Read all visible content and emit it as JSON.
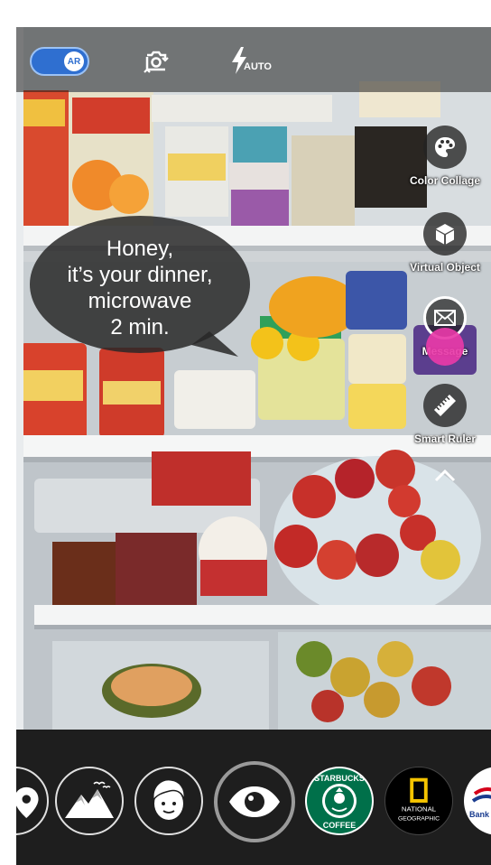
{
  "toolbar": {
    "ar_label": "AR",
    "ar_enabled": true,
    "camera_switch_icon": "camera-switch-icon",
    "flash_icon": "flash-auto-icon",
    "flash_label": "AUTO"
  },
  "bubble": {
    "lines": [
      "Honey,",
      "it’s your dinner,",
      "microwave",
      "2 min."
    ]
  },
  "side_tools": [
    {
      "label": "Color Collage",
      "icon": "palette-icon"
    },
    {
      "label": "Virtual Object",
      "icon": "cube-icon"
    },
    {
      "label": "Message",
      "icon": "envelope-icon",
      "selected": true
    },
    {
      "label": "Smart Ruler",
      "icon": "ruler-icon"
    }
  ],
  "filters": [
    {
      "name": "location",
      "icon": "location-pin-icon"
    },
    {
      "name": "mountains",
      "icon": "mountains-icon"
    },
    {
      "name": "face",
      "icon": "face-icon"
    },
    {
      "name": "eye",
      "icon": "eye-icon",
      "selected": true
    },
    {
      "name": "Starbucks",
      "icon": "starbucks-logo",
      "text_top": "STARBUCKS",
      "text_bottom": "COFFEE"
    },
    {
      "name": "National Geographic",
      "icon": "natgeo-logo",
      "text_1": "NATIONAL",
      "text_2": "GEOGRAPHIC"
    },
    {
      "name": "Bank of America",
      "icon": "bank-logo",
      "text": "Bank"
    }
  ],
  "colors": {
    "accent": "#2f6fd0",
    "pink_marker": "#e83aa8",
    "bar_bg": "#1e1e1e"
  }
}
